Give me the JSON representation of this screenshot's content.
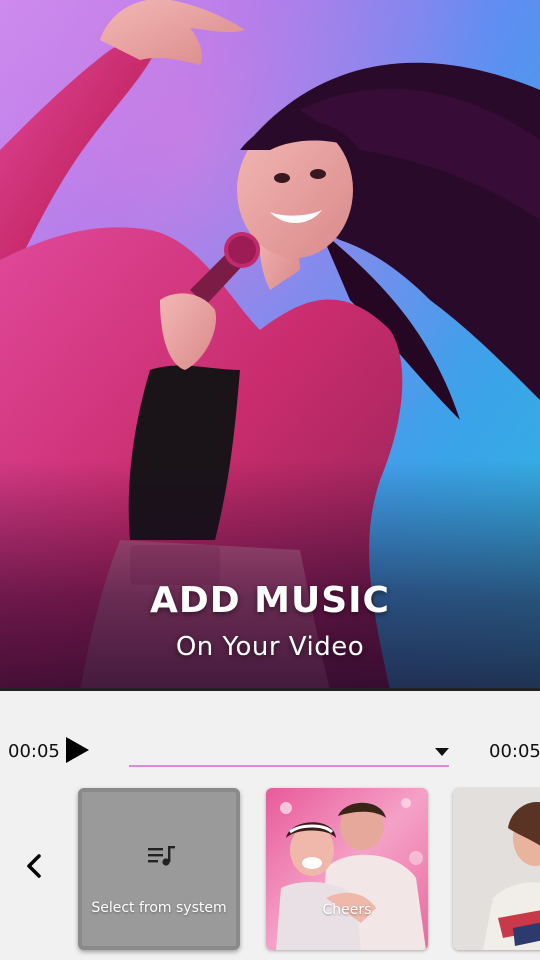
{
  "hero": {
    "title": "ADD MUSIC",
    "subtitle": "On Your Video"
  },
  "player": {
    "current_time": "00:05",
    "total_time": "00:05",
    "selected_track": ""
  },
  "music_list": {
    "items": [
      {
        "label": "Select from system",
        "icon": "playlist-icon"
      },
      {
        "label": "Cheers",
        "image": "couple-cheers-photo"
      },
      {
        "label": "",
        "image": "woman-portrait-photo"
      }
    ]
  },
  "colors": {
    "panel_bg": "#f1f1f1",
    "track_underline": "#e088e0",
    "hero_gradient_start": "#c68cf2",
    "hero_gradient_end": "#2fb6df",
    "jacket": "#d0337a"
  }
}
